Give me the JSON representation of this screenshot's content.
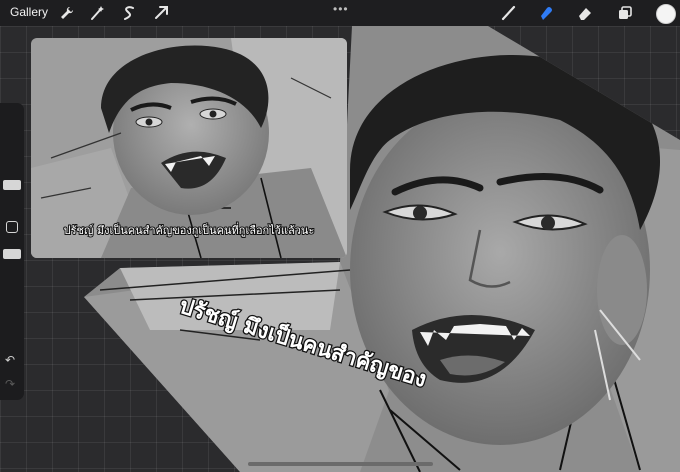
{
  "toolbar": {
    "gallery_label": "Gallery",
    "left_icons": [
      "wrench-icon",
      "magic-wand-icon",
      "selection-icon",
      "transform-arrow-icon"
    ],
    "more_label": "•••",
    "right_icons": [
      "brush-icon",
      "smudge-icon",
      "eraser-icon",
      "layers-icon"
    ],
    "active_tool": "smudge-icon",
    "accent_color": "#2f7cf6",
    "current_color": "#f4f4f4"
  },
  "sidebar": {
    "controls": [
      "brush-size-slider",
      "modify-button",
      "opacity-slider",
      "undo-button",
      "redo-button"
    ],
    "undo_label": "↶",
    "redo_label": "↷"
  },
  "canvas": {
    "panel_small": {
      "caption": "ปรัชญ์ มึงเป็นคนสำคัญของกูเป็นคนที่กูเลือกไว้แล้วนะ"
    },
    "panel_large": {
      "caption": "ปรัชญ์ มึงเป็นคนสำคัญของ"
    }
  }
}
